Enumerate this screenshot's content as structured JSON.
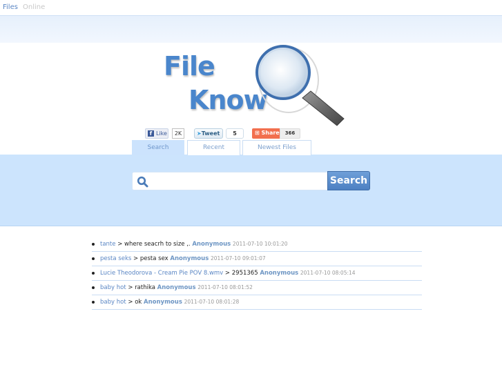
{
  "topnav": {
    "files_label": "Files",
    "online_label": "Online"
  },
  "logo": {
    "line1": "File",
    "line2": "Know",
    "icon": "magnifying-glass-icon"
  },
  "social": {
    "facebook": {
      "label": "Like",
      "count": "2K",
      "icon": "facebook-icon"
    },
    "twitter": {
      "label": "Tweet",
      "count": "5",
      "icon": "twitter-bird-icon"
    },
    "share": {
      "label": "Share",
      "count": "366",
      "icon": "plus-icon"
    }
  },
  "tabs": [
    {
      "label": "Search",
      "active": true
    },
    {
      "label": "Recent",
      "active": false
    },
    {
      "label": "Newest Files",
      "active": false
    }
  ],
  "search": {
    "value": "",
    "placeholder": "",
    "button_label": "Search",
    "icon": "search-icon"
  },
  "recent_searches": [
    {
      "query": "tante",
      "sep": ">",
      "term": "where seacrh to size ,.",
      "user": "Anonymous",
      "time": "2011-07-10 10:01:20"
    },
    {
      "query": "pesta seks",
      "sep": ">",
      "term": "pesta sex",
      "user": "Anonymous",
      "time": "2011-07-10 09:01:07"
    },
    {
      "query": "Lucie Theodorova - Cream Pie POV 8.wmv",
      "sep": ">",
      "term": "2951365",
      "user": "Anonymous",
      "time": "2011-07-10 08:05:14"
    },
    {
      "query": "baby hot",
      "sep": ">",
      "term": "rathika",
      "user": "Anonymous",
      "time": "2011-07-10 08:01:52"
    },
    {
      "query": "baby hot",
      "sep": ">",
      "term": "ok",
      "user": "Anonymous",
      "time": "2011-07-10 08:01:28"
    }
  ],
  "colors": {
    "accent": "#4a86cc",
    "search_band": "#cce4fd",
    "search_button": "#5b8ccb",
    "link": "#5a86c4"
  }
}
